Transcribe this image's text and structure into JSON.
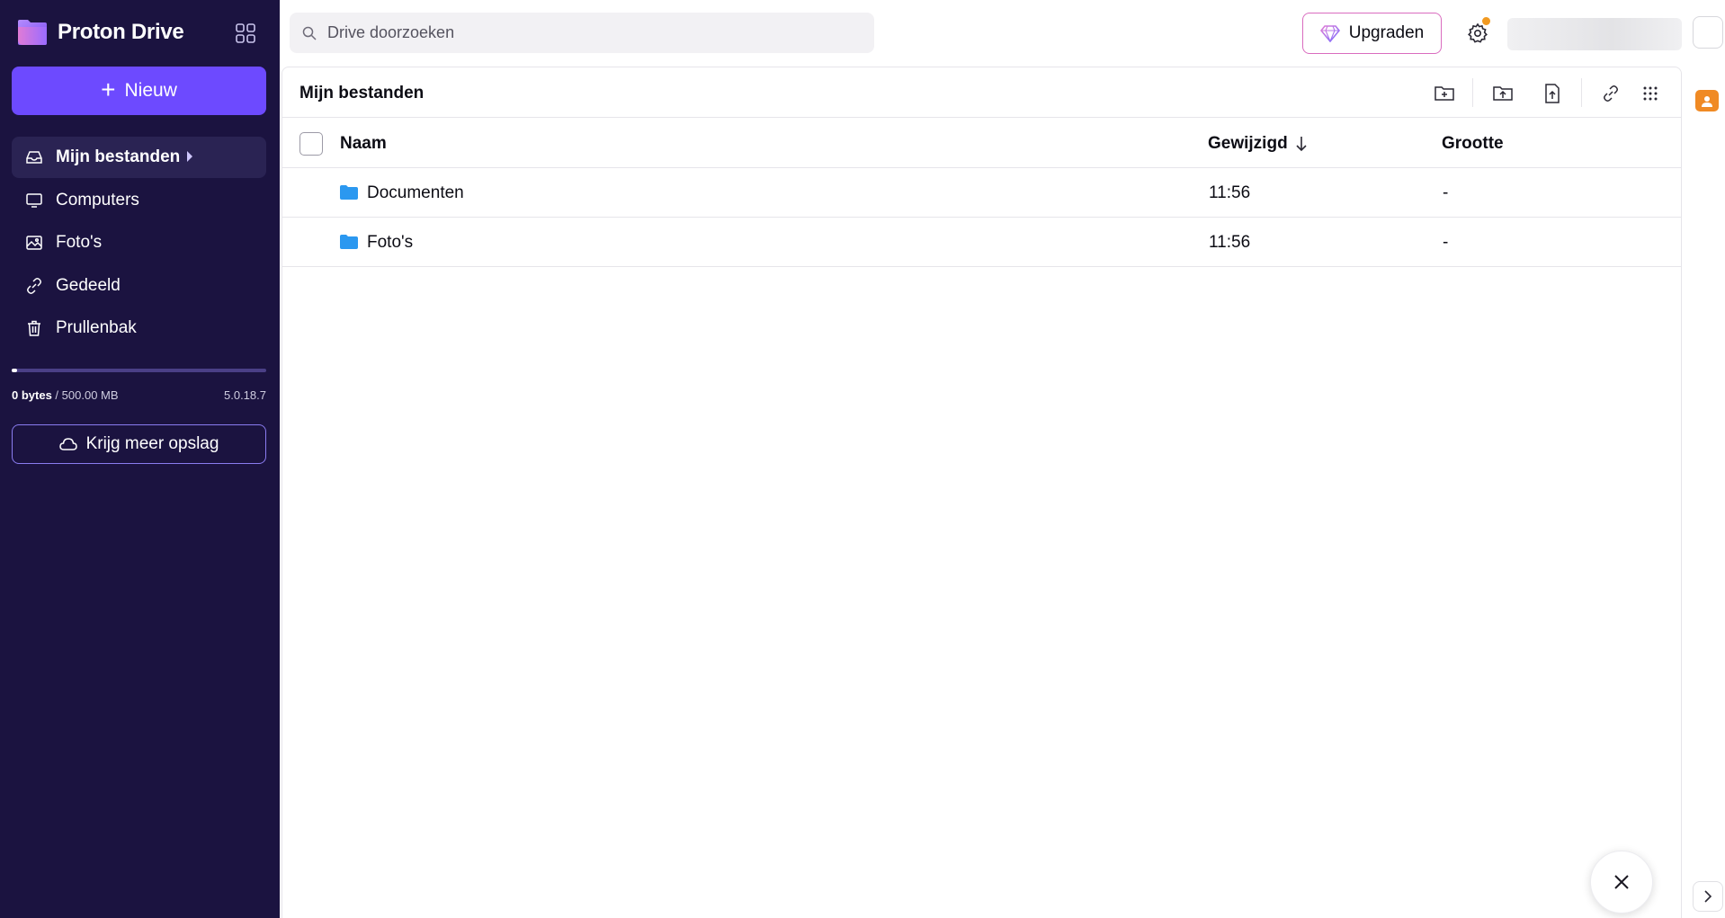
{
  "app": {
    "name": "Proton Drive"
  },
  "sidebar": {
    "new_label": "Nieuw",
    "items": [
      {
        "label": "Mijn bestanden",
        "icon": "inbox-icon",
        "active": true
      },
      {
        "label": "Computers",
        "icon": "monitor-icon"
      },
      {
        "label": "Foto's",
        "icon": "image-icon"
      },
      {
        "label": "Gedeeld",
        "icon": "link-icon"
      },
      {
        "label": "Prullenbak",
        "icon": "trash-icon"
      }
    ],
    "storage": {
      "used": "0 bytes",
      "separator": " / ",
      "total": "500.00 MB",
      "fill_fraction": 0.02
    },
    "version": "5.0.18.7",
    "more_storage_label": "Krijg meer opslag"
  },
  "header": {
    "search_placeholder": "Drive doorzoeken",
    "upgrade_label": "Upgraden"
  },
  "main": {
    "title": "Mijn bestanden",
    "columns": {
      "name": "Naam",
      "modified": "Gewijzigd",
      "size": "Grootte"
    },
    "rows": [
      {
        "name": "Documenten",
        "modified": "11:56",
        "size": "-"
      },
      {
        "name": "Foto's",
        "modified": "11:56",
        "size": "-"
      }
    ]
  },
  "colors": {
    "sidebar_bg": "#1b1340",
    "accent": "#6d4aff",
    "folder": "#2b98f0",
    "notification_dot": "#f19a21"
  }
}
